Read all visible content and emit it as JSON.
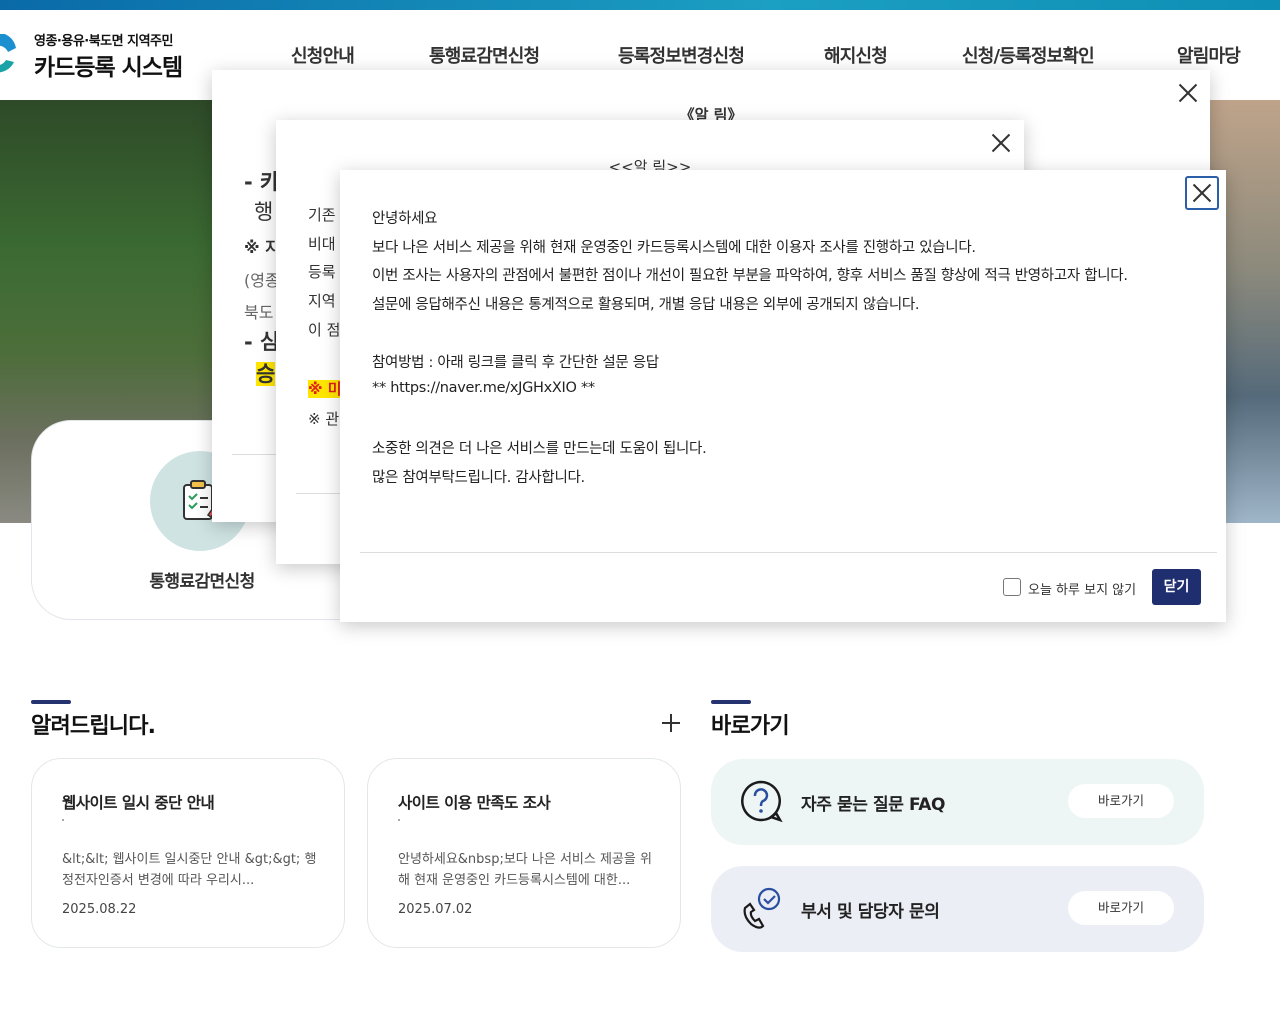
{
  "header": {
    "logo_sub": "영종·용유·북도면 지역주민",
    "logo_main": "카드등록 시스템",
    "nav": [
      "신청안내",
      "통행료감면신청",
      "등록정보변경신청",
      "해지신청",
      "신청/등록정보확인",
      "알림마당"
    ]
  },
  "feature": {
    "label": "통행료감면신청"
  },
  "popup1": {
    "title": "《알  림》",
    "lines": [
      "- 카",
      "행",
      "※ 지",
      "(영종",
      "북도",
      "- 심",
      "승"
    ]
  },
  "popup2": {
    "title": "<<알 림>>",
    "lines": [
      "기존",
      "비대",
      "등록",
      "지역",
      "이 점",
      "※ 미",
      "※ 관"
    ]
  },
  "popup3": {
    "lines": [
      "안녕하세요",
      "보다 나은 서비스 제공을 위해 현재 운영중인 카드등록시스템에 대한 이용자 조사를 진행하고 있습니다.",
      "이번 조사는 사용자의 관점에서 불편한 점이나 개선이 필요한 부분을 파악하여, 향후 서비스 품질 향상에 적극 반영하고자 합니다.",
      "설문에 응답해주신 내용은 통계적으로 활용되며, 개별 응답 내용은 외부에 공개되지 않습니다.",
      "참여방법 : 아래 링크를 클릭 후 간단한 설문 응답",
      "** https://naver.me/xJGHxXIO **",
      "소중한 의견은 더 나은 서비스를 만드는데 도움이 됩니다.",
      "많은 참여부탁드립니다. 감사합니다."
    ],
    "checkbox_label": "오늘 하루 보지 않기",
    "close_label": "닫기"
  },
  "notices": {
    "title": "알려드립니다.",
    "items": [
      {
        "title": "웹사이트 일시 중단 안내",
        "body": "&lt;&lt; 웹사이트 일시중단 안내 &gt;&gt; 행정전자인증서 변경에 따라 우리시...",
        "date": "2025.08.22"
      },
      {
        "title": "사이트 이용 만족도 조사",
        "body": "안녕하세요&nbsp;보다 나은 서비스 제공을 위해 현재 운영중인 카드등록시스템에 대한...",
        "date": "2025.07.02"
      }
    ]
  },
  "quick": {
    "title": "바로가기",
    "items": [
      {
        "label": "자주 묻는 질문 FAQ",
        "button": "바로가기",
        "bg": "#edf5f5"
      },
      {
        "label": "부서 및 담당자 문의",
        "button": "바로가기",
        "bg": "#eceef6"
      }
    ]
  },
  "colors": {
    "accent_navy": "#1f2e6e",
    "highlight_yellow": "#ffe600",
    "warn_red": "#e01e1e"
  }
}
